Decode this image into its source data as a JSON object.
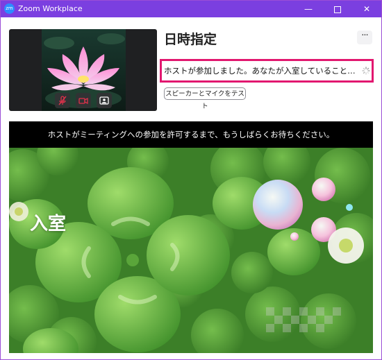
{
  "window": {
    "app_logo": "zm",
    "title": "Zoom Workplace",
    "minimize_glyph": "—",
    "close_glyph": "✕"
  },
  "meeting": {
    "title": "日時指定",
    "more_label": "···",
    "status_message": "ホストが参加しました。あなたが入室していることがホス…",
    "test_button_label": "スピーカーとマイクをテスト"
  },
  "preview": {
    "controls": [
      "mic-muted-icon",
      "camera-off-icon",
      "background-icon"
    ]
  },
  "waiting_room": {
    "message": "ホストがミーティングへの参加を許可するまで、もうしばらくお待ちください。",
    "image_caption": "入室"
  },
  "colors": {
    "titlebar": "#7b3fe0",
    "highlight_border": "#e2176f",
    "muted_icon": "#e0314b"
  }
}
